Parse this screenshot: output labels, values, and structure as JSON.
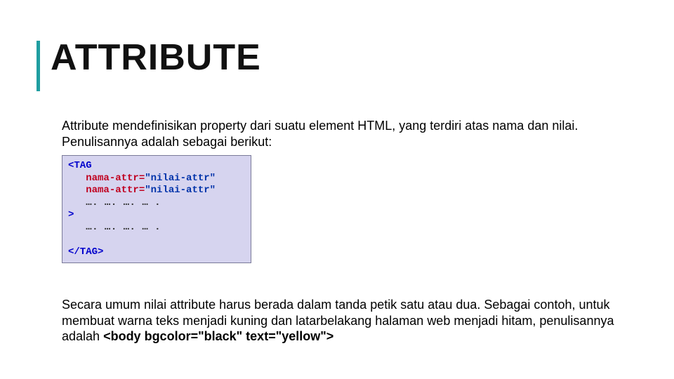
{
  "slide": {
    "title": "ATTRIBUTE",
    "intro": "Attribute mendefinisikan property dari suatu element HTML, yang terdiri atas nama dan nilai. Penulisannya adalah sebagai berikut:",
    "code": {
      "open_tag": "<TAG",
      "attr1_name": "nama-attr",
      "attr1_value": "\"nilai-attr\"",
      "attr2_name": "nama-attr",
      "attr2_value": "\"nilai-attr\"",
      "dots1": "…. …. …. … .",
      "close_angle": ">",
      "dots2": "…. …. …. … .",
      "close_tag": "</TAG>"
    },
    "para2_plain": "Secara umum nilai attribute harus berada dalam tanda petik satu atau dua. Sebagai contoh, untuk membuat warna teks menjadi kuning dan latarbelakang halaman web menjadi hitam, penulisannya adalah ",
    "para2_bold": "<body bgcolor=\"black\" text=\"yellow\">"
  }
}
